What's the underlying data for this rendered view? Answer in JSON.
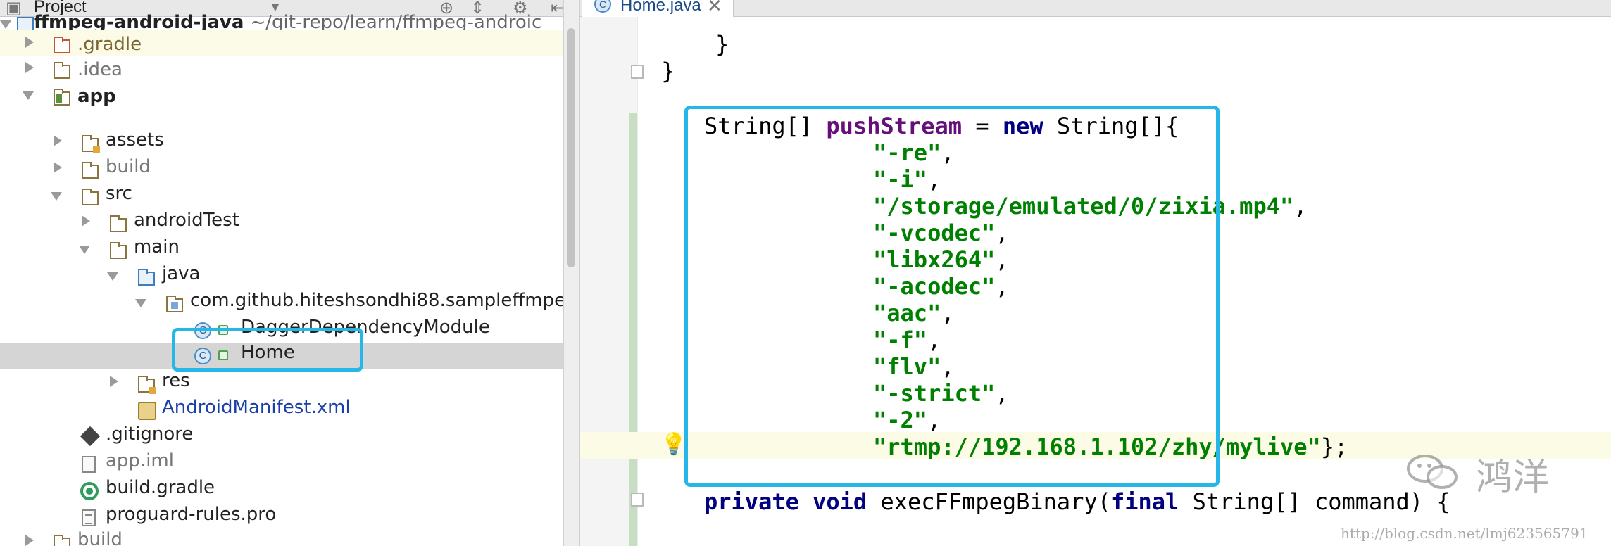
{
  "project_panel": {
    "title": "Project",
    "tree": [
      {
        "label": "ffmpeg-android-java",
        "path": "~/git-repo/learn/ffmpeg-androic"
      },
      {
        "label": ".gradle"
      },
      {
        "label": ".idea"
      },
      {
        "label": "app"
      },
      {
        "label": "assets"
      },
      {
        "label": "build"
      },
      {
        "label": "src"
      },
      {
        "label": "androidTest"
      },
      {
        "label": "main"
      },
      {
        "label": "java"
      },
      {
        "label": "com.github.hiteshsondhi88.sampleffmpeg"
      },
      {
        "label": "DaggerDependencyModule"
      },
      {
        "label": "Home"
      },
      {
        "label": "res"
      },
      {
        "label": "AndroidManifest.xml"
      },
      {
        "label": ".gitignore"
      },
      {
        "label": "app.iml"
      },
      {
        "label": "build.gradle"
      },
      {
        "label": "proguard-rules.pro"
      },
      {
        "label": "build"
      }
    ]
  },
  "editor": {
    "tab": {
      "icon": "C",
      "label": "Home.java",
      "close": "✕"
    },
    "code": {
      "l0": "        }",
      "l1": "    }",
      "decl_type": "String[] ",
      "decl_var": "pushStream",
      "decl_eq": " = ",
      "decl_new": "new",
      "decl_tail": " String[]{",
      "args": [
        "\"-re\"",
        "\"-i\"",
        "\"/storage/emulated/0/zixia.mp4\"",
        "\"-vcodec\"",
        "\"libx264\"",
        "\"-acodec\"",
        "\"aac\"",
        "\"-f\"",
        "\"flv\"",
        "\"-strict\"",
        "\"-2\"",
        "\"rtmp://192.168.1.102/zhy/mylive\""
      ],
      "arg_sep": ",",
      "arg_end": "};",
      "m_private": "private",
      "m_void": "void",
      "m_name": " execFFmpegBinary(",
      "m_final": "final",
      "m_tail": " String[] command) {"
    }
  },
  "watermark": {
    "text": "鸿洋",
    "url": "http://blog.csdn.net/lmj623565791"
  },
  "colors": {
    "highlight_box": "#26b7e8",
    "keyword": "#000080",
    "field": "#660e7a",
    "string": "#008000"
  },
  "icons": {
    "tree_expand": "chevron-right-icon",
    "tree_collapse": "chevron-down-icon",
    "folder": "folder-icon",
    "class": "class-icon",
    "bulb": "lightbulb-icon"
  }
}
